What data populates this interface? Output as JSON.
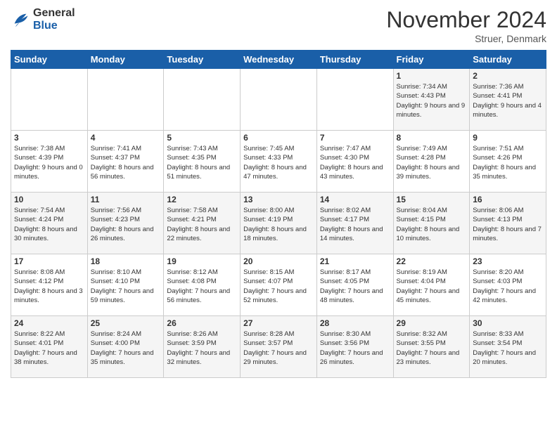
{
  "header": {
    "logo_general": "General",
    "logo_blue": "Blue",
    "month_title": "November 2024",
    "location": "Struer, Denmark"
  },
  "days_of_week": [
    "Sunday",
    "Monday",
    "Tuesday",
    "Wednesday",
    "Thursday",
    "Friday",
    "Saturday"
  ],
  "weeks": [
    [
      {
        "day": "",
        "sunrise": "",
        "sunset": "",
        "daylight": ""
      },
      {
        "day": "",
        "sunrise": "",
        "sunset": "",
        "daylight": ""
      },
      {
        "day": "",
        "sunrise": "",
        "sunset": "",
        "daylight": ""
      },
      {
        "day": "",
        "sunrise": "",
        "sunset": "",
        "daylight": ""
      },
      {
        "day": "",
        "sunrise": "",
        "sunset": "",
        "daylight": ""
      },
      {
        "day": "1",
        "sunrise": "Sunrise: 7:34 AM",
        "sunset": "Sunset: 4:43 PM",
        "daylight": "Daylight: 9 hours and 9 minutes."
      },
      {
        "day": "2",
        "sunrise": "Sunrise: 7:36 AM",
        "sunset": "Sunset: 4:41 PM",
        "daylight": "Daylight: 9 hours and 4 minutes."
      }
    ],
    [
      {
        "day": "3",
        "sunrise": "Sunrise: 7:38 AM",
        "sunset": "Sunset: 4:39 PM",
        "daylight": "Daylight: 9 hours and 0 minutes."
      },
      {
        "day": "4",
        "sunrise": "Sunrise: 7:41 AM",
        "sunset": "Sunset: 4:37 PM",
        "daylight": "Daylight: 8 hours and 56 minutes."
      },
      {
        "day": "5",
        "sunrise": "Sunrise: 7:43 AM",
        "sunset": "Sunset: 4:35 PM",
        "daylight": "Daylight: 8 hours and 51 minutes."
      },
      {
        "day": "6",
        "sunrise": "Sunrise: 7:45 AM",
        "sunset": "Sunset: 4:33 PM",
        "daylight": "Daylight: 8 hours and 47 minutes."
      },
      {
        "day": "7",
        "sunrise": "Sunrise: 7:47 AM",
        "sunset": "Sunset: 4:30 PM",
        "daylight": "Daylight: 8 hours and 43 minutes."
      },
      {
        "day": "8",
        "sunrise": "Sunrise: 7:49 AM",
        "sunset": "Sunset: 4:28 PM",
        "daylight": "Daylight: 8 hours and 39 minutes."
      },
      {
        "day": "9",
        "sunrise": "Sunrise: 7:51 AM",
        "sunset": "Sunset: 4:26 PM",
        "daylight": "Daylight: 8 hours and 35 minutes."
      }
    ],
    [
      {
        "day": "10",
        "sunrise": "Sunrise: 7:54 AM",
        "sunset": "Sunset: 4:24 PM",
        "daylight": "Daylight: 8 hours and 30 minutes."
      },
      {
        "day": "11",
        "sunrise": "Sunrise: 7:56 AM",
        "sunset": "Sunset: 4:23 PM",
        "daylight": "Daylight: 8 hours and 26 minutes."
      },
      {
        "day": "12",
        "sunrise": "Sunrise: 7:58 AM",
        "sunset": "Sunset: 4:21 PM",
        "daylight": "Daylight: 8 hours and 22 minutes."
      },
      {
        "day": "13",
        "sunrise": "Sunrise: 8:00 AM",
        "sunset": "Sunset: 4:19 PM",
        "daylight": "Daylight: 8 hours and 18 minutes."
      },
      {
        "day": "14",
        "sunrise": "Sunrise: 8:02 AM",
        "sunset": "Sunset: 4:17 PM",
        "daylight": "Daylight: 8 hours and 14 minutes."
      },
      {
        "day": "15",
        "sunrise": "Sunrise: 8:04 AM",
        "sunset": "Sunset: 4:15 PM",
        "daylight": "Daylight: 8 hours and 10 minutes."
      },
      {
        "day": "16",
        "sunrise": "Sunrise: 8:06 AM",
        "sunset": "Sunset: 4:13 PM",
        "daylight": "Daylight: 8 hours and 7 minutes."
      }
    ],
    [
      {
        "day": "17",
        "sunrise": "Sunrise: 8:08 AM",
        "sunset": "Sunset: 4:12 PM",
        "daylight": "Daylight: 8 hours and 3 minutes."
      },
      {
        "day": "18",
        "sunrise": "Sunrise: 8:10 AM",
        "sunset": "Sunset: 4:10 PM",
        "daylight": "Daylight: 7 hours and 59 minutes."
      },
      {
        "day": "19",
        "sunrise": "Sunrise: 8:12 AM",
        "sunset": "Sunset: 4:08 PM",
        "daylight": "Daylight: 7 hours and 56 minutes."
      },
      {
        "day": "20",
        "sunrise": "Sunrise: 8:15 AM",
        "sunset": "Sunset: 4:07 PM",
        "daylight": "Daylight: 7 hours and 52 minutes."
      },
      {
        "day": "21",
        "sunrise": "Sunrise: 8:17 AM",
        "sunset": "Sunset: 4:05 PM",
        "daylight": "Daylight: 7 hours and 48 minutes."
      },
      {
        "day": "22",
        "sunrise": "Sunrise: 8:19 AM",
        "sunset": "Sunset: 4:04 PM",
        "daylight": "Daylight: 7 hours and 45 minutes."
      },
      {
        "day": "23",
        "sunrise": "Sunrise: 8:20 AM",
        "sunset": "Sunset: 4:03 PM",
        "daylight": "Daylight: 7 hours and 42 minutes."
      }
    ],
    [
      {
        "day": "24",
        "sunrise": "Sunrise: 8:22 AM",
        "sunset": "Sunset: 4:01 PM",
        "daylight": "Daylight: 7 hours and 38 minutes."
      },
      {
        "day": "25",
        "sunrise": "Sunrise: 8:24 AM",
        "sunset": "Sunset: 4:00 PM",
        "daylight": "Daylight: 7 hours and 35 minutes."
      },
      {
        "day": "26",
        "sunrise": "Sunrise: 8:26 AM",
        "sunset": "Sunset: 3:59 PM",
        "daylight": "Daylight: 7 hours and 32 minutes."
      },
      {
        "day": "27",
        "sunrise": "Sunrise: 8:28 AM",
        "sunset": "Sunset: 3:57 PM",
        "daylight": "Daylight: 7 hours and 29 minutes."
      },
      {
        "day": "28",
        "sunrise": "Sunrise: 8:30 AM",
        "sunset": "Sunset: 3:56 PM",
        "daylight": "Daylight: 7 hours and 26 minutes."
      },
      {
        "day": "29",
        "sunrise": "Sunrise: 8:32 AM",
        "sunset": "Sunset: 3:55 PM",
        "daylight": "Daylight: 7 hours and 23 minutes."
      },
      {
        "day": "30",
        "sunrise": "Sunrise: 8:33 AM",
        "sunset": "Sunset: 3:54 PM",
        "daylight": "Daylight: 7 hours and 20 minutes."
      }
    ]
  ]
}
